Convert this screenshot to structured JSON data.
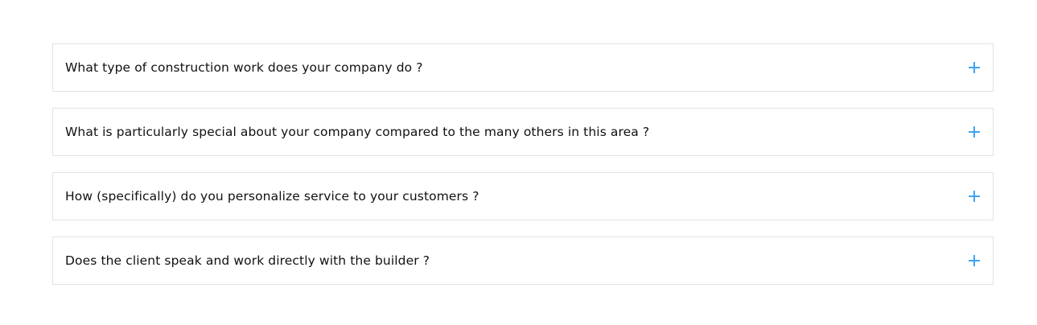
{
  "faq": {
    "items": [
      {
        "question": "What type of construction work does your company do ?",
        "icon": "plus-icon"
      },
      {
        "question": "What is particularly special about your company compared to the many others in this area ?",
        "icon": "plus-icon"
      },
      {
        "question": "How (specifically) do you personalize service to your customers ?",
        "icon": "plus-icon"
      },
      {
        "question": "Does the client speak and work directly with the builder ?",
        "icon": "plus-icon"
      }
    ]
  },
  "colors": {
    "accent": "#3fa2f0",
    "border": "#e3e3e3",
    "text": "#111111",
    "background": "#ffffff"
  }
}
